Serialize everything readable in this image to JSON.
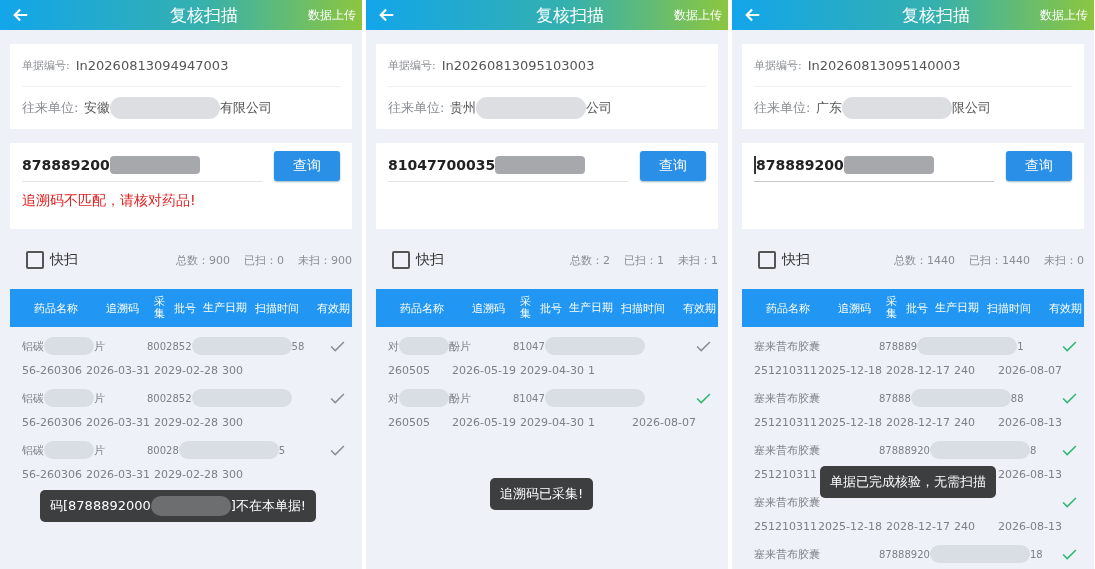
{
  "screens": [
    {
      "title": "复核扫描",
      "upload": "数据上传",
      "doc_label": "单据编号:",
      "doc_no": "In20260813094947003",
      "partner_label": "往来单位:",
      "partner": [
        {
          "kind": "text",
          "text": "安徽"
        },
        {
          "kind": "blur"
        },
        {
          "kind": "text",
          "text": "有限公司"
        }
      ],
      "input": {
        "value": [
          {
            "kind": "text",
            "text": "878889200"
          },
          {
            "kind": "blur"
          }
        ],
        "focused": false
      },
      "query": "查询",
      "error": "追溯码不匹配，请核对药品!",
      "quick": {
        "label": "快扫",
        "checked": false
      },
      "counts": [
        "总数：900",
        "已扫：0",
        "未扫：900"
      ],
      "columns": [
        "药品名称",
        "追溯码",
        "采集",
        "批号",
        "生产日期",
        "扫描时间",
        "有效期"
      ],
      "rows": [
        {
          "name": [
            {
              "kind": "text",
              "text": "铝碳"
            },
            {
              "kind": "blur"
            },
            {
              "kind": "text",
              "text": "片"
            }
          ],
          "code": [
            {
              "kind": "text",
              "text": "8002852"
            },
            {
              "kind": "blur"
            },
            {
              "kind": "text",
              "text": "58"
            }
          ],
          "batch": "56-260306",
          "prod_date": "2026-03-31",
          "expiry": "2029-02-28",
          "qty": "300",
          "collected": false
        },
        {
          "name": [
            {
              "kind": "text",
              "text": "铝碳"
            },
            {
              "kind": "blur"
            },
            {
              "kind": "text",
              "text": "片"
            }
          ],
          "code": [
            {
              "kind": "text",
              "text": "8002852"
            },
            {
              "kind": "blur"
            }
          ],
          "batch": "56-260306",
          "prod_date": "2026-03-31",
          "expiry": "2029-02-28",
          "qty": "300",
          "collected": false
        },
        {
          "name": [
            {
              "kind": "text",
              "text": "铝碳"
            },
            {
              "kind": "blur"
            },
            {
              "kind": "text",
              "text": "片"
            }
          ],
          "code": [
            {
              "kind": "text",
              "text": "80028"
            },
            {
              "kind": "blur"
            },
            {
              "kind": "text",
              "text": "5"
            }
          ],
          "batch": "56-260306",
          "prod_date": "2026-03-31",
          "expiry": "2029-02-28",
          "qty": "300",
          "collected": false
        }
      ],
      "toast": [
        {
          "kind": "text",
          "text": "码[8788892000"
        },
        {
          "kind": "blur"
        },
        {
          "kind": "text",
          "text": "]不在本单据!"
        }
      ]
    },
    {
      "title": "复核扫描",
      "upload": "数据上传",
      "doc_label": "单据编号:",
      "doc_no": "In20260813095103003",
      "partner_label": "往来单位:",
      "partner": [
        {
          "kind": "text",
          "text": "贵州"
        },
        {
          "kind": "blur"
        },
        {
          "kind": "text",
          "text": "公司"
        }
      ],
      "input": {
        "value": [
          {
            "kind": "text",
            "text": "81047700035"
          },
          {
            "kind": "blur"
          }
        ],
        "focused": false
      },
      "query": "查询",
      "quick": {
        "label": "快扫",
        "checked": false
      },
      "counts": [
        "总数：2",
        "已扫：1",
        "未扫：1"
      ],
      "columns": [
        "药品名称",
        "追溯码",
        "采集",
        "批号",
        "生产日期",
        "扫描时间",
        "有效期"
      ],
      "rows": [
        {
          "name": [
            {
              "kind": "text",
              "text": "对"
            },
            {
              "kind": "blur"
            },
            {
              "kind": "text",
              "text": "酚片"
            }
          ],
          "code": [
            {
              "kind": "text",
              "text": "81047"
            },
            {
              "kind": "blur"
            }
          ],
          "batch": "260505",
          "prod_date": "2026-05-19",
          "expiry": "2029-04-30",
          "qty": "1",
          "collected": false
        },
        {
          "name": [
            {
              "kind": "text",
              "text": "对"
            },
            {
              "kind": "blur"
            },
            {
              "kind": "text",
              "text": "酚片"
            }
          ],
          "code": [
            {
              "kind": "text",
              "text": "81047"
            },
            {
              "kind": "blur"
            }
          ],
          "batch": "260505",
          "prod_date": "2026-05-19",
          "expiry": "2029-04-30",
          "qty": "1",
          "scan_time": "2026-08-07",
          "collected": true
        }
      ],
      "toast": [
        {
          "kind": "text",
          "text": "追溯码已采集!"
        }
      ]
    },
    {
      "title": "复核扫描",
      "upload": "数据上传",
      "doc_label": "单据编号:",
      "doc_no": "In20260813095140003",
      "partner_label": "往来单位:",
      "partner": [
        {
          "kind": "text",
          "text": "广东"
        },
        {
          "kind": "blur"
        },
        {
          "kind": "text",
          "text": "限公司"
        }
      ],
      "input": {
        "value": [
          {
            "kind": "text",
            "text": "878889200"
          },
          {
            "kind": "blur"
          }
        ],
        "focused": true
      },
      "query": "查询",
      "quick": {
        "label": "快扫",
        "checked": false
      },
      "counts": [
        "总数：1440",
        "已扫：1440",
        "未扫：0"
      ],
      "columns": [
        "药品名称",
        "追溯码",
        "采集",
        "批号",
        "生产日期",
        "扫描时间",
        "有效期"
      ],
      "rows": [
        {
          "name": [
            {
              "kind": "text",
              "text": "塞来昔布胶囊"
            }
          ],
          "code": [
            {
              "kind": "text",
              "text": "878889"
            },
            {
              "kind": "blur"
            },
            {
              "kind": "text",
              "text": "1"
            }
          ],
          "batch": "251210311",
          "prod_date": "2025-12-18",
          "expiry": "2028-12-17",
          "qty": "240",
          "scan_time": "2026-08-07",
          "collected": true
        },
        {
          "name": [
            {
              "kind": "text",
              "text": "塞来昔布胶囊"
            }
          ],
          "code": [
            {
              "kind": "text",
              "text": "87888"
            },
            {
              "kind": "blur"
            },
            {
              "kind": "text",
              "text": "88"
            }
          ],
          "batch": "251210311",
          "prod_date": "2025-12-18",
          "expiry": "2028-12-17",
          "qty": "240",
          "scan_time": "2026-08-13",
          "collected": true
        },
        {
          "name": [
            {
              "kind": "text",
              "text": "塞来昔布胶囊"
            }
          ],
          "code": [
            {
              "kind": "text",
              "text": "87888920"
            },
            {
              "kind": "blur"
            },
            {
              "kind": "text",
              "text": "8"
            }
          ],
          "batch": "251210311",
          "scan_time": "2026-08-13",
          "collected": true
        },
        {
          "name": [
            {
              "kind": "text",
              "text": "塞来昔布胶囊"
            }
          ],
          "batch": "251210311",
          "prod_date": "2025-12-18",
          "expiry": "2028-12-17",
          "qty": "240",
          "scan_time": "2026-08-13",
          "collected": true
        },
        {
          "name": [
            {
              "kind": "text",
              "text": "塞来昔布胶囊"
            }
          ],
          "code": [
            {
              "kind": "text",
              "text": "87888920"
            },
            {
              "kind": "blur"
            },
            {
              "kind": "text",
              "text": "18"
            }
          ],
          "collected": true
        }
      ],
      "toast": [
        {
          "kind": "text",
          "text": "单据已完成核验，无需扫描"
        }
      ]
    }
  ]
}
